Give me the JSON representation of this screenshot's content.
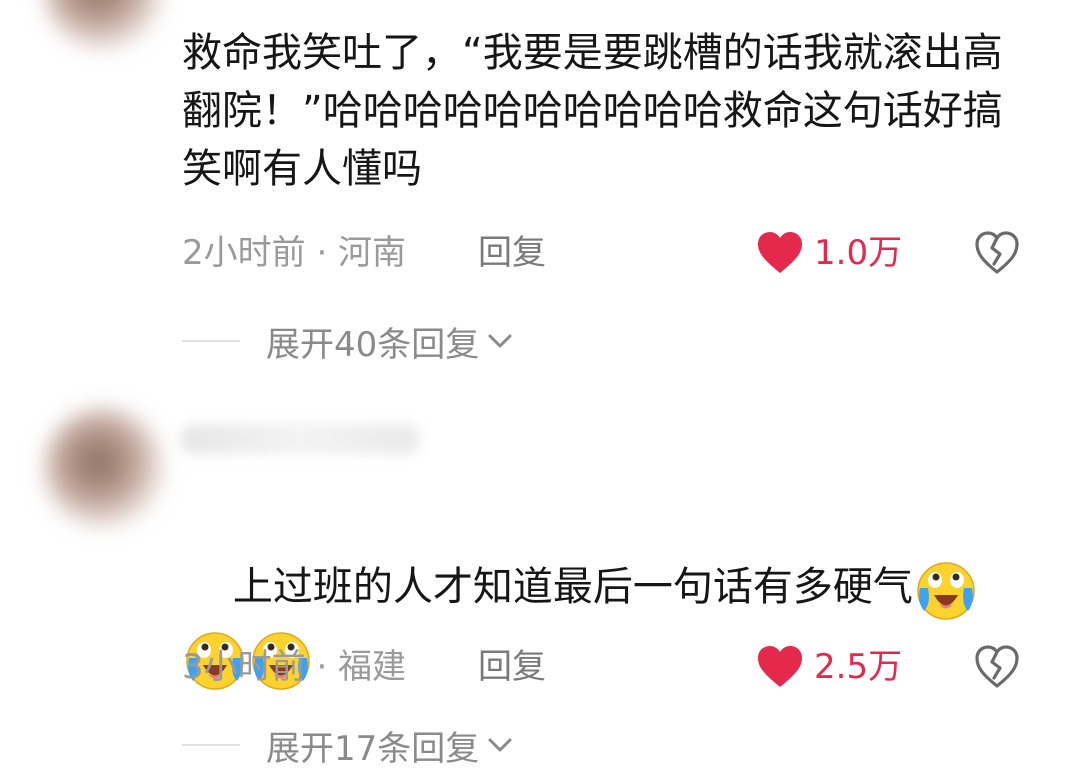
{
  "comments": [
    {
      "text": "救命我笑吐了，“我要是要跳槽的话我就滚出高翻院！”哈哈哈哈哈哈哈哈哈哈救命这句话好搞笑啊有人懂吗",
      "emojis": [],
      "time_location": "2小时前 · 河南",
      "reply_label": "回复",
      "likes": "1.0万",
      "expand_label": "展开40条回复"
    },
    {
      "text": "上过班的人才知道最后一句话有多硬气",
      "emojis": [
        "crying-laughing-emoji",
        "crying-laughing-emoji",
        "crying-laughing-emoji"
      ],
      "time_location": "3小时前 · 福建",
      "reply_label": "回复",
      "likes": "2.5万",
      "expand_label": "展开17条回复"
    }
  ],
  "colors": {
    "like_red": "#e5294d",
    "meta_gray": "#9a9a9a",
    "reply_gray": "#7a7a7a",
    "text_dark": "#161616"
  }
}
